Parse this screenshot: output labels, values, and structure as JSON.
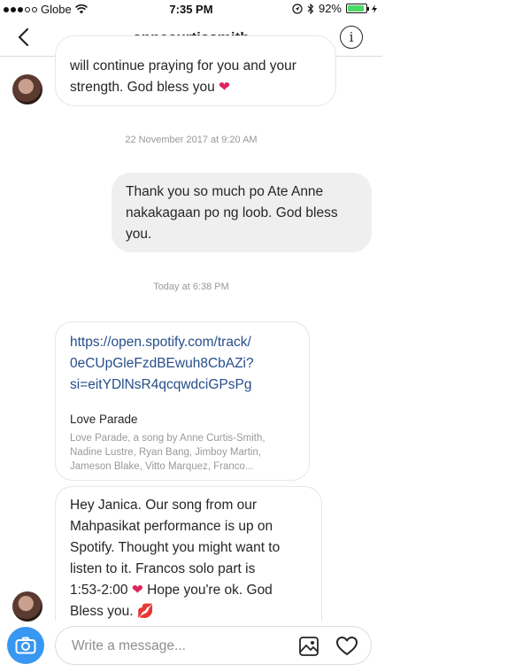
{
  "status_bar": {
    "carrier": "Globe",
    "time": "7:35 PM",
    "battery_percent": "92%",
    "battery_level": 0.92,
    "icons": [
      "wifi-icon",
      "location-icon",
      "bluetooth-icon",
      "battery-icon",
      "charging-icon"
    ]
  },
  "header": {
    "username": "annecurtissmith",
    "back_icon": "chevron-left-icon",
    "info_icon": "info-icon",
    "info_glyph": "i"
  },
  "messages": {
    "incoming_1": {
      "line1": "will continue praying for you and your",
      "line2": "strength. God bless you",
      "emoji": "❤"
    },
    "timestamp_1": "22 November 2017 at 9:20 AM",
    "outgoing_1": {
      "line1": "Thank you so much po Ate Anne",
      "line2": "nakakagaan po ng loob. God bless",
      "line3": "you."
    },
    "timestamp_2": "Today at 6:38 PM",
    "link_card": {
      "url_line1": "https://open.spotify.com/track/",
      "url_line2": "0eCUpGleFzdBEwuh8CbAZi?",
      "url_line3": "si=eitYDlNsR4qcqwdciGPsPg",
      "title": "Love Parade",
      "desc_line1": "Love Parade, a song by Anne Curtis-Smith,",
      "desc_line2": "Nadine Lustre, Ryan Bang, Jimboy Martin,",
      "desc_line3": "Jameson Blake, Vitto Marquez, Franco..."
    },
    "incoming_2": {
      "line1": "Hey Janica. Our song from our",
      "line2": "Mahpasikat performance is up on",
      "line3": "Spotify. Thought you might want to",
      "line4": "listen to it. Francos solo part is",
      "line5a": "1:53-2:00",
      "heart": "❤",
      "line5b": "Hope you're ok. God",
      "line6": "Bless you.",
      "kiss": "💋"
    }
  },
  "composer": {
    "placeholder": "Write a message...",
    "camera_icon": "camera-icon",
    "gallery_icon": "gallery-icon",
    "heart_icon": "heart-icon"
  },
  "colors": {
    "accent_blue": "#3897f0",
    "link_blue": "#264e8a",
    "heart_red": "#e0245e",
    "outgoing_bubble": "#efefef"
  }
}
